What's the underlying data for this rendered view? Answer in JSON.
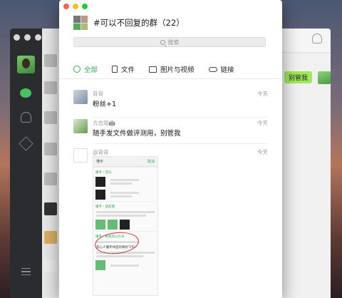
{
  "background_window": {
    "outgoing_bubble": "别管我"
  },
  "dialog": {
    "title": "#可以不回复的群（22）",
    "search_placeholder": "搜索",
    "tabs": [
      {
        "label": "全部",
        "icon": "chat-bubble-icon",
        "active": true
      },
      {
        "label": "文件",
        "icon": "file-icon",
        "active": false
      },
      {
        "label": "图片与视频",
        "icon": "image-icon",
        "active": false
      },
      {
        "label": "链接",
        "icon": "link-icon",
        "active": false
      }
    ],
    "messages": [
      {
        "sender": "背背",
        "time": "今天",
        "text": "粉丝+1"
      },
      {
        "sender": "方志瑶🤖",
        "time": "今天",
        "text": "随手发文件做评测用，别管我"
      },
      {
        "sender": "@背背",
        "time": "今天",
        "text": ""
      }
    ],
    "attached_image": {
      "search_text": "懂专",
      "cancel_label": "取消",
      "sections": [
        "懂专・音乐",
        "懂专・朋友圈",
        "懂专・相关的公众号"
      ],
      "more_label": "更多 >",
      "circled_text": "友心人懂专共度的奇妙下午"
    }
  },
  "colors": {
    "accent_green": "#3aa85a",
    "bubble_green": "#a0e75a",
    "sidebar_dark": "#2b2c2f"
  }
}
